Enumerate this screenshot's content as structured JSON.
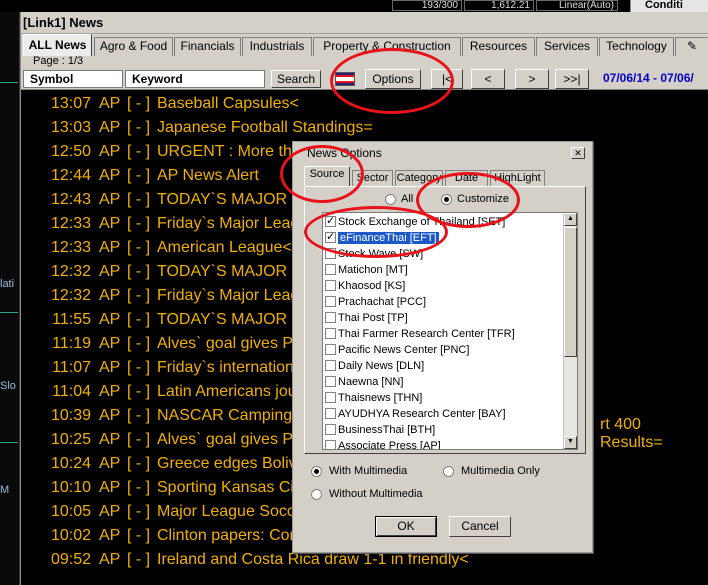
{
  "background": {
    "top_values": [
      "193/300",
      "1,612.21",
      "Linear(Auto)"
    ],
    "right_label": "Conditi",
    "left_fragments": [
      "lati",
      "Slo",
      "M"
    ]
  },
  "window": {
    "title": "[Link1] News",
    "tabs": [
      "ALL News",
      "Agro & Food",
      "Financials",
      "Industrials",
      "Property & Construction",
      "Resources",
      "Services",
      "Technology",
      "✎"
    ],
    "page_label": "Page : 1/3",
    "toolbar": {
      "symbol_label": "Symbol",
      "keyword_label": "Keyword",
      "search_label": "Search",
      "options_label": "Options",
      "first_label": "|<",
      "prev_label": "<",
      "next_label": ">",
      "last_label": ">>|",
      "date_range": "07/06/14 - 07/06/"
    }
  },
  "news": [
    {
      "time": "13:07",
      "source": "AP",
      "bracket": "[ - ]",
      "headline": "Baseball Capsules<"
    },
    {
      "time": "13:03",
      "source": "AP",
      "bracket": "[ - ]",
      "headline": "Japanese Football Standings="
    },
    {
      "time": "12:50",
      "source": "AP",
      "bracket": "[ - ]",
      "headline": "URGENT : More th"
    },
    {
      "time": "12:44",
      "source": "AP",
      "bracket": "[ - ]",
      "headline": "AP News Alert"
    },
    {
      "time": "12:43",
      "source": "AP",
      "bracket": "[ - ]",
      "headline": "TODAY`S MAJOR"
    },
    {
      "time": "12:33",
      "source": "AP",
      "bracket": "[ - ]",
      "headline": "Friday`s Major Leag"
    },
    {
      "time": "12:33",
      "source": "AP",
      "bracket": "[ - ]",
      "headline": "American League<"
    },
    {
      "time": "12:32",
      "source": "AP",
      "bracket": "[ - ]",
      "headline": "TODAY`S MAJOR"
    },
    {
      "time": "12:32",
      "source": "AP",
      "bracket": "[ - ]",
      "headline": "Friday`s Major Leag"
    },
    {
      "time": "11:55",
      "source": "AP",
      "bracket": "[ - ]",
      "headline": "TODAY`S MAJOR"
    },
    {
      "time": "11:19",
      "source": "AP",
      "bracket": "[ - ]",
      "headline": "Alves` goal gives Po"
    },
    {
      "time": "11:07",
      "source": "AP",
      "bracket": "[ - ]",
      "headline": "Friday`s internationa"
    },
    {
      "time": "11:04",
      "source": "AP",
      "bracket": "[ - ]",
      "headline": "Latin Americans jou"
    },
    {
      "time": "10:39",
      "source": "AP",
      "bracket": "[ - ]",
      "headline": "NASCAR Camping"
    },
    {
      "time": "10:25",
      "source": "AP",
      "bracket": "[ - ]",
      "headline": "Alves` goal gives Po"
    },
    {
      "time": "10:24",
      "source": "AP",
      "bracket": "[ - ]",
      "headline": "Greece edges Boliv"
    },
    {
      "time": "10:10",
      "source": "AP",
      "bracket": "[ - ]",
      "headline": "Sporting Kansas Cit"
    },
    {
      "time": "10:05",
      "source": "AP",
      "bracket": "[ - ]",
      "headline": "Major League Socc"
    },
    {
      "time": "10:02",
      "source": "AP",
      "bracket": "[ - ]",
      "headline": "Clinton papers: Con"
    },
    {
      "time": "09:52",
      "source": "AP",
      "bracket": "[ - ]",
      "headline": "Ireland and Costa Rica draw 1-1 in friendly<"
    }
  ],
  "news_extra": "rt 400 Results=",
  "dialog": {
    "title": "News Options",
    "close": "✕",
    "tabs": [
      "Source",
      "Sector",
      "Category",
      "Date",
      "HighLight"
    ],
    "all_label": "All",
    "customize_label": "Customize",
    "sources": [
      {
        "label": "Stock Exchange of Thailand [SET]",
        "checked": true
      },
      {
        "label": "eFinanceThai [EFT]",
        "checked": true
      },
      {
        "label": "Stock Wave [SW]",
        "checked": false
      },
      {
        "label": "Matichon [MT]",
        "checked": false
      },
      {
        "label": "Khaosod [KS]",
        "checked": false
      },
      {
        "label": "Prachachat [PCC]",
        "checked": false
      },
      {
        "label": "Thai Post [TP]",
        "checked": false
      },
      {
        "label": "Thai Farmer Research Center [TFR]",
        "checked": false
      },
      {
        "label": "Pacific News Center [PNC]",
        "checked": false
      },
      {
        "label": "Daily News [DLN]",
        "checked": false
      },
      {
        "label": "Naewna [NN]",
        "checked": false
      },
      {
        "label": "Thaisnews [THN]",
        "checked": false
      },
      {
        "label": "AYUDHYA Research Center [BAY]",
        "checked": false
      },
      {
        "label": "BusinessThai [BTH]",
        "checked": false
      },
      {
        "label": "Associate Press [AP]",
        "checked": false
      }
    ],
    "with_multimedia": "With Multimedia",
    "multimedia_only": "Multimedia Only",
    "without_multimedia": "Without Multimedia",
    "ok_label": "OK",
    "cancel_label": "Cancel"
  },
  "colors": {
    "headline": "#f1b000",
    "annotation": "#e8121a",
    "date": "#0000cc",
    "selection": "#1c58c8"
  }
}
